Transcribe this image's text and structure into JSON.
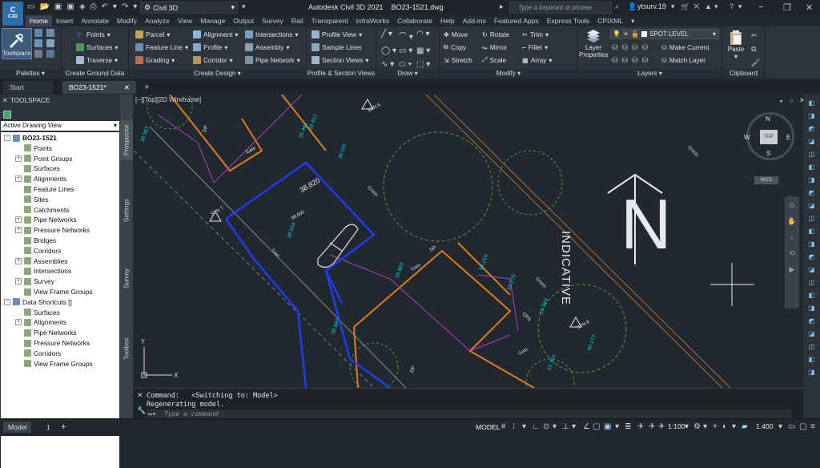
{
  "app": {
    "badge_top": "C",
    "badge_bottom": "C3D",
    "window_title": "Autodesk Civil 3D 2021",
    "document_title": "BO23-1521.dwg"
  },
  "workspace": {
    "name": "Civil 3D"
  },
  "search": {
    "placeholder": "Type a keyword or phrase"
  },
  "user": {
    "name": "ytsurv.19"
  },
  "ribbon_tabs": [
    "Home",
    "Insert",
    "Annotate",
    "Modify",
    "Analyze",
    "View",
    "Manage",
    "Output",
    "Survey",
    "Rail",
    "Transparent",
    "InfraWorks",
    "Collaborate",
    "Help",
    "Add-ins",
    "Featured Apps",
    "Express Tools",
    "CPIXML"
  ],
  "active_tab": "Home",
  "panels": {
    "palettes": {
      "title": "Palettes",
      "toolspace": "Toolspace"
    },
    "ground": {
      "title": "Create Ground Data",
      "items": [
        "Points",
        "Surfaces",
        "Traverse"
      ]
    },
    "design": {
      "title": "Create Design",
      "col1": [
        "Parcel",
        "Feature Line",
        "Grading"
      ],
      "col2": [
        "Alignment",
        "Profile",
        "Corridor"
      ],
      "col3": [
        "Intersections",
        "Assembly",
        "Pipe Network"
      ]
    },
    "profile": {
      "title": "Profile & Section Views",
      "items": [
        "Profile View",
        "Sample Lines",
        "Section Views"
      ]
    },
    "draw": {
      "title": "Draw"
    },
    "modify": {
      "title": "Modify",
      "col1": [
        "Move",
        "Copy",
        "Stretch"
      ],
      "col2": [
        "Rotate",
        "Mirror",
        "Scale"
      ],
      "col3": [
        "Trim",
        "Fillet",
        "Array"
      ]
    },
    "layers": {
      "title": "Layers",
      "layer_properties": "Layer Properties",
      "current_layer": "SPOT LEVEL",
      "make_current": "Make Current",
      "match_layer": "Match Layer"
    },
    "clipboard": {
      "title": "Clipboard",
      "paste": "Paste"
    }
  },
  "doc_tabs": [
    "Start",
    "BO23-1521*"
  ],
  "toolspace": {
    "title": "TOOLSPACE",
    "view_select": "Active Drawing View",
    "vertical_tabs": [
      "Prospector",
      "Settings",
      "Survey",
      "Toolbox"
    ],
    "tree": [
      {
        "label": "BO23-1521",
        "level": 0,
        "exp": "-",
        "bold": true
      },
      {
        "label": "Points",
        "level": 1,
        "exp": ""
      },
      {
        "label": "Point Groups",
        "level": 1,
        "exp": "+"
      },
      {
        "label": "Surfaces",
        "level": 1,
        "exp": ""
      },
      {
        "label": "Alignments",
        "level": 1,
        "exp": "+"
      },
      {
        "label": "Feature Lines",
        "level": 1,
        "exp": ""
      },
      {
        "label": "Sites",
        "level": 1,
        "exp": ""
      },
      {
        "label": "Catchments",
        "level": 1,
        "exp": ""
      },
      {
        "label": "Pipe Networks",
        "level": 1,
        "exp": "+"
      },
      {
        "label": "Pressure Networks",
        "level": 1,
        "exp": "+"
      },
      {
        "label": "Bridges",
        "level": 1,
        "exp": ""
      },
      {
        "label": "Corridors",
        "level": 1,
        "exp": ""
      },
      {
        "label": "Assemblies",
        "level": 1,
        "exp": "+"
      },
      {
        "label": "Intersections",
        "level": 1,
        "exp": ""
      },
      {
        "label": "Survey",
        "level": 1,
        "exp": "+"
      },
      {
        "label": "View Frame Groups",
        "level": 1,
        "exp": ""
      },
      {
        "label": "Data Shortcuts []",
        "level": 0,
        "exp": "-"
      },
      {
        "label": "Surfaces",
        "level": 1,
        "exp": ""
      },
      {
        "label": "Alignments",
        "level": 1,
        "exp": "+"
      },
      {
        "label": "Pipe Networks",
        "level": 1,
        "exp": ""
      },
      {
        "label": "Pressure Networks",
        "level": 1,
        "exp": ""
      },
      {
        "label": "Corridors",
        "level": 1,
        "exp": ""
      },
      {
        "label": "View Frame Groups",
        "level": 1,
        "exp": ""
      }
    ]
  },
  "viewport": {
    "label": "[−][Top][2D Wireframe]",
    "viewcube": {
      "face": "TOP",
      "n": "N",
      "s": "S",
      "e": "E",
      "w": "W",
      "wcs": "WCS"
    },
    "north_text": "INDICATIVE",
    "north_letter": "N",
    "labels": [
      "38.820",
      "Tree",
      "Grass",
      "Grass",
      "Grass",
      "Gate",
      "Gate",
      "STN 7",
      "STN 6",
      "STN 8",
      "CPS",
      "DP",
      "DP",
      "DP",
      "Gate",
      "38.930",
      "38.600"
    ]
  },
  "command": {
    "line1": "Command:   <Switching to: Model>",
    "line2": "Regenerating model.",
    "placeholder": "Type a command"
  },
  "status": {
    "model_tab": "Model",
    "layout_tab": "1",
    "model_label": "MODEL",
    "scale": "1:100",
    "lineweight": "1.400"
  }
}
